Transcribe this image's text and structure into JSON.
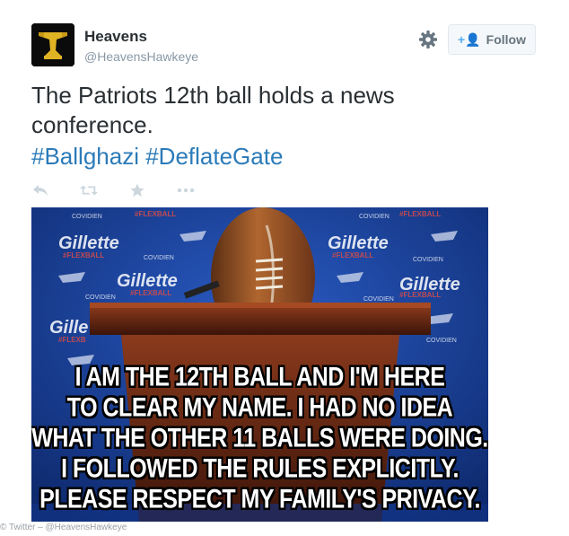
{
  "tweet": {
    "user": {
      "name": "Heavens",
      "handle": "@HeavensHawkeye"
    },
    "follow_label": "Follow",
    "text": "The Patriots 12th ball holds a news conference.",
    "hashtags": [
      "#Ballghazi",
      "#DeflateGate"
    ],
    "actions": [
      "reply-icon",
      "retweet-icon",
      "favorite-icon",
      "more-icon"
    ]
  },
  "photo": {
    "caption_lines": [
      "I AM THE 12TH BALL AND I'M HERE",
      "TO CLEAR MY NAME. I HAD NO IDEA",
      "WHAT THE OTHER 11 BALLS WERE DOING.",
      "I FOLLOWED THE RULES EXPLICITLY.",
      "PLEASE RESPECT MY FAMILY'S PRIVACY."
    ],
    "backdrop_labels": [
      "Gillette",
      "#FLEXBALL",
      "COVIDIEN"
    ]
  },
  "credit": "© Twitter – @HeavensHawkeye",
  "colors": {
    "link": "#2b7bb9",
    "text": "#292f33",
    "muted": "#8899a6",
    "backdrop_blue": "#173f94"
  }
}
